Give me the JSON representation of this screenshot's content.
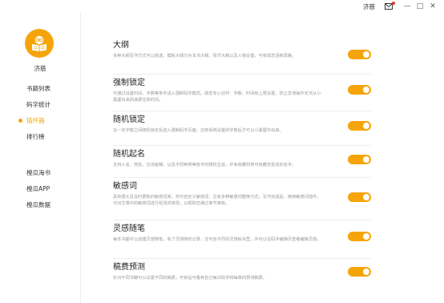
{
  "window": {
    "user_name": "济慈",
    "minimize": "—",
    "maximize": "□",
    "close": "✕"
  },
  "sidebar": {
    "avatar_icon": "book-reader-avatar",
    "user_name": "济慈",
    "items": [
      {
        "label": "书籍列表",
        "active": false
      },
      {
        "label": "码字统计",
        "active": false
      },
      {
        "label": "插件箱",
        "active": true
      },
      {
        "label": "排行榜",
        "active": false
      },
      {
        "label": "橙瓜海书",
        "active": false
      },
      {
        "label": "橙瓜APP",
        "active": false
      },
      {
        "label": "橙瓜数据",
        "active": false
      }
    ]
  },
  "features": [
    {
      "title": "大纲",
      "desc": "多种大纲写作方式可以挑选，模板大纲分为本书大纲、情节大纲以及人物设置，可有助您清晰思路。",
      "enabled": true
    },
    {
      "title": "强制锁定",
      "desc": "可通过设置时间、字数等条件进入强制码字模式。助您专心创作：字数、时间有上限设置，防止您误操作无法从小黑屋出来而浪费宝贵时间。",
      "enabled": true
    },
    {
      "title": "随机锁定",
      "desc": "在一定字数之间随机锁定后进入强制码字页面，达到系统设置的字数后才可以小黑屋中出来。",
      "enabled": true
    },
    {
      "title": "随机起名",
      "desc": "支持人名、地名、功法秘籍、以及不同种类等各字的随机生成，并有收藏列表可收藏您喜欢的名字。",
      "enabled": true
    },
    {
      "title": "敏感词",
      "desc": "具有强大且及时更新的敏感词库，并可自定义敏感词，且有多种敏感词替换方式。写作完成后，使用敏感词插件，可对文章中的敏感词进行检测并修改，以帮助您通过审节审核。",
      "enabled": true
    },
    {
      "title": "灵感随笔",
      "desc": "每本书都可以创建灵感随笔，有了灵感随时记录，还可自不同的灵感板块里，并可以在码字编辑页查看编辑灵感。",
      "enabled": true
    },
    {
      "title": "稿费预测",
      "desc": "针对不同书籍可以设置不同的稿费，开启后可看到自己每次码字和每章的预测稿费。",
      "enabled": true
    }
  ],
  "colors": {
    "accent": "#f5a50b",
    "badge": "#e03c31"
  }
}
